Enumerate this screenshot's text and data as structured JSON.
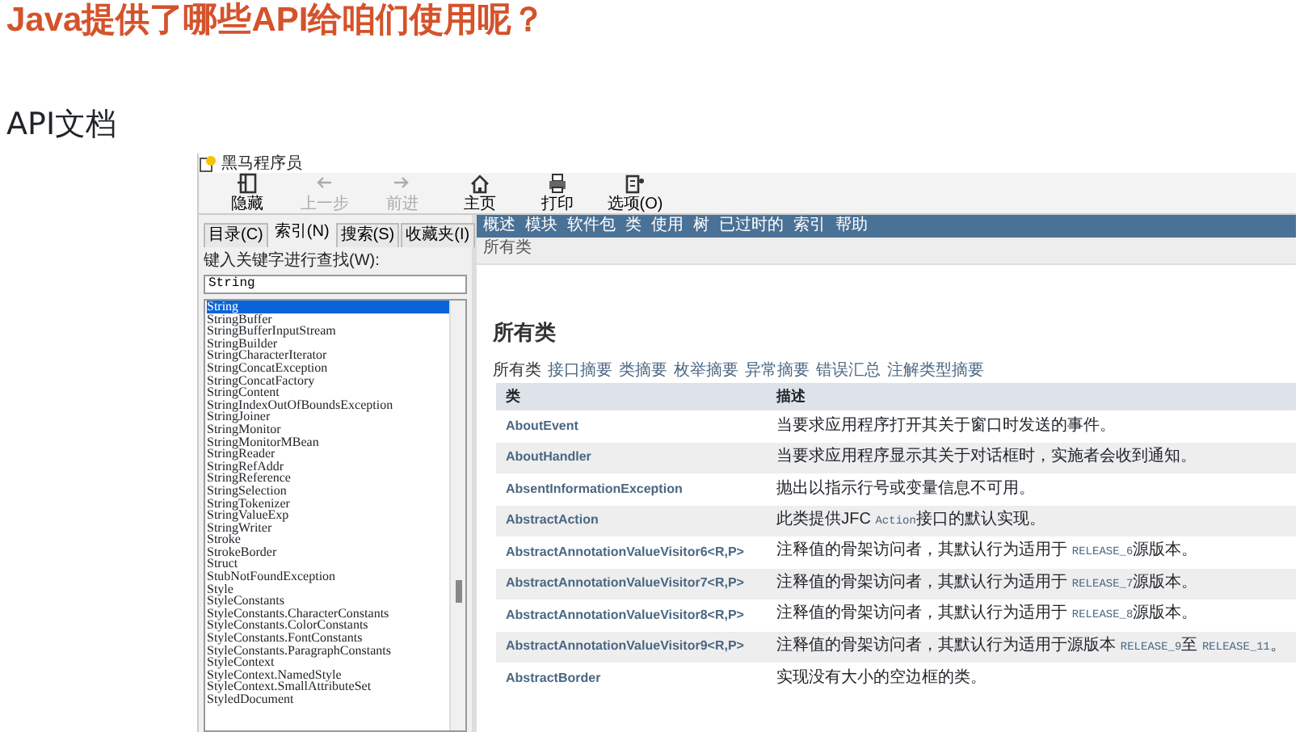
{
  "slide": {
    "title": "Java提供了哪些API给咱们使用呢？",
    "subtitle": "API文档"
  },
  "window": {
    "title": "黑马程序员",
    "toolbar": [
      {
        "kind": "hide",
        "label": "隐藏",
        "disabled": false
      },
      {
        "kind": "back",
        "label": "上一步",
        "disabled": true
      },
      {
        "kind": "forward",
        "label": "前进",
        "disabled": true
      },
      {
        "kind": "home",
        "label": "主页",
        "disabled": false
      },
      {
        "kind": "print",
        "label": "打印",
        "disabled": false
      },
      {
        "kind": "options",
        "label": "选项(O)",
        "disabled": false
      }
    ],
    "tabs": [
      {
        "label": "目录(C)",
        "selected": false
      },
      {
        "label": "索引(N)",
        "selected": true
      },
      {
        "label": "搜索(S)",
        "selected": false
      },
      {
        "label": "收藏夹(I)",
        "selected": false
      }
    ],
    "search": {
      "label": "键入关键字进行查找(W):",
      "value": "String"
    },
    "index_list": [
      {
        "label": "String",
        "selected": true
      },
      {
        "label": "StringBuffer",
        "selected": false
      },
      {
        "label": "StringBufferInputStream",
        "selected": false
      },
      {
        "label": "StringBuilder",
        "selected": false
      },
      {
        "label": "StringCharacterIterator",
        "selected": false
      },
      {
        "label": "StringConcatException",
        "selected": false
      },
      {
        "label": "StringConcatFactory",
        "selected": false
      },
      {
        "label": "StringContent",
        "selected": false
      },
      {
        "label": "StringIndexOutOfBoundsException",
        "selected": false
      },
      {
        "label": "StringJoiner",
        "selected": false
      },
      {
        "label": "StringMonitor",
        "selected": false
      },
      {
        "label": "StringMonitorMBean",
        "selected": false
      },
      {
        "label": "StringReader",
        "selected": false
      },
      {
        "label": "StringRefAddr",
        "selected": false
      },
      {
        "label": "StringReference",
        "selected": false
      },
      {
        "label": "StringSelection",
        "selected": false
      },
      {
        "label": "StringTokenizer",
        "selected": false
      },
      {
        "label": "StringValueExp",
        "selected": false
      },
      {
        "label": "StringWriter",
        "selected": false
      },
      {
        "label": "Stroke",
        "selected": false
      },
      {
        "label": "StrokeBorder",
        "selected": false
      },
      {
        "label": "Struct",
        "selected": false
      },
      {
        "label": "StubNotFoundException",
        "selected": false
      },
      {
        "label": "Style",
        "selected": false
      },
      {
        "label": "StyleConstants",
        "selected": false
      },
      {
        "label": "StyleConstants.CharacterConstants",
        "selected": false
      },
      {
        "label": "StyleConstants.ColorConstants",
        "selected": false
      },
      {
        "label": "StyleConstants.FontConstants",
        "selected": false
      },
      {
        "label": "StyleConstants.ParagraphConstants",
        "selected": false
      },
      {
        "label": "StyleContext",
        "selected": false
      },
      {
        "label": "StyleContext.NamedStyle",
        "selected": false
      },
      {
        "label": "StyleContext.SmallAttributeSet",
        "selected": false
      },
      {
        "label": "StyledDocument",
        "selected": false
      }
    ],
    "doc": {
      "nav_menu": [
        "概述",
        "模块",
        "软件包",
        "类",
        "使用",
        "树",
        "已过时的",
        "索引",
        "帮助"
      ],
      "breadcrumb": "所有类",
      "heading": "所有类",
      "filter_links": [
        {
          "label": "所有类",
          "selected": true
        },
        {
          "label": "接口摘要",
          "selected": false
        },
        {
          "label": "类摘要",
          "selected": false
        },
        {
          "label": "枚举摘要",
          "selected": false
        },
        {
          "label": "异常摘要",
          "selected": false
        },
        {
          "label": "错误汇总",
          "selected": false
        },
        {
          "label": "注解类型摘要",
          "selected": false
        }
      ],
      "table": {
        "columns": [
          "类",
          "描述"
        ],
        "rows": [
          {
            "class": "AboutEvent",
            "description": [
              {
                "kind": "text",
                "text": "当要求应用程序打开其关于窗口时发送的事件。"
              }
            ]
          },
          {
            "class": "AboutHandler",
            "description": [
              {
                "kind": "text",
                "text": "当要求应用程序显示其关于对话框时，实施者会收到通知。"
              }
            ]
          },
          {
            "class": "AbsentInformationException",
            "description": [
              {
                "kind": "text",
                "text": "抛出以指示行号或变量信息不可用。"
              }
            ]
          },
          {
            "class": "AbstractAction",
            "description": [
              {
                "kind": "text",
                "text": "此类提供JFC "
              },
              {
                "kind": "code",
                "text": "Action"
              },
              {
                "kind": "text",
                "text": "接口的默认实现。"
              }
            ]
          },
          {
            "class": "AbstractAnnotationValueVisitor6<R,P>",
            "description": [
              {
                "kind": "text",
                "text": "注释值的骨架访问者，其默认行为适用于 "
              },
              {
                "kind": "code",
                "text": "RELEASE_6"
              },
              {
                "kind": "text",
                "text": "源版本。"
              }
            ]
          },
          {
            "class": "AbstractAnnotationValueVisitor7<R,P>",
            "description": [
              {
                "kind": "text",
                "text": "注释值的骨架访问者，其默认行为适用于 "
              },
              {
                "kind": "code",
                "text": "RELEASE_7"
              },
              {
                "kind": "text",
                "text": "源版本。"
              }
            ]
          },
          {
            "class": "AbstractAnnotationValueVisitor8<R,P>",
            "description": [
              {
                "kind": "text",
                "text": "注释值的骨架访问者，其默认行为适用于 "
              },
              {
                "kind": "code",
                "text": "RELEASE_8"
              },
              {
                "kind": "text",
                "text": "源版本。"
              }
            ]
          },
          {
            "class": "AbstractAnnotationValueVisitor9<R,P>",
            "description": [
              {
                "kind": "text",
                "text": "注释值的骨架访问者，其默认行为适用于源版本 "
              },
              {
                "kind": "code",
                "text": "RELEASE_9"
              },
              {
                "kind": "text",
                "text": "至 "
              },
              {
                "kind": "code",
                "text": "RELEASE_11"
              },
              {
                "kind": "text",
                "text": "。"
              }
            ]
          },
          {
            "class": "AbstractBorder",
            "description": [
              {
                "kind": "text",
                "text": "实现没有大小的空边框的类。"
              }
            ]
          }
        ]
      }
    }
  }
}
